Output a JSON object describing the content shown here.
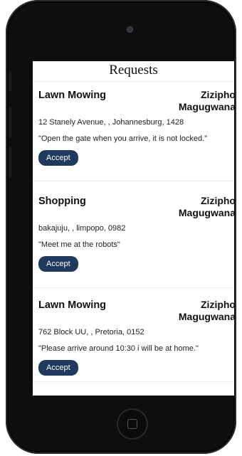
{
  "screen": {
    "title": "Requests"
  },
  "requests": [
    {
      "service": "Lawn Mowing",
      "requester": "Zizipho Magugwana",
      "address": "12 Stanely Avenue, , Johannesburg, 1428",
      "note": "\"Open the gate when you arrive, it is not locked.\"",
      "accept_label": "Accept"
    },
    {
      "service": "Shopping",
      "requester": "Zizipho Magugwana",
      "address": "bakajuju, , limpopo, 0982",
      "note": "\"Meet me at the robots\"",
      "accept_label": "Accept"
    },
    {
      "service": "Lawn Mowing",
      "requester": "Zizipho Magugwana",
      "address": "762 Block UU, , Pretoria, 0152",
      "note": "\"Please arrive around 10:30 i will be at home.\"",
      "accept_label": "Accept"
    }
  ],
  "colors": {
    "accent": "#1f3a5c",
    "phone_body": "#0e0e0e"
  },
  "icons": {
    "home": "home-button-icon",
    "camera": "front-camera-icon"
  }
}
